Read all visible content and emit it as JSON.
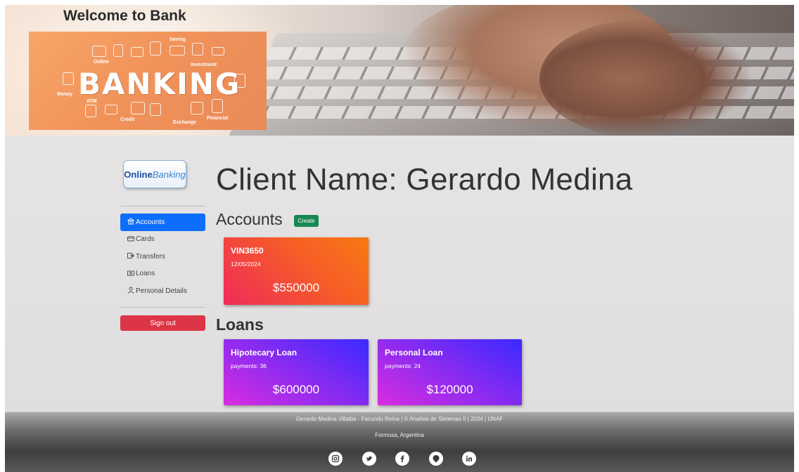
{
  "header": {
    "welcome": "Welcome to Bank",
    "banner_logo": {
      "main_text": "BANKING",
      "words": [
        "Online",
        "Saving",
        "Investment",
        "Money",
        "ATM",
        "Credit",
        "Exchange",
        "Financial"
      ]
    }
  },
  "logo": {
    "part1": "Online",
    "part2": "Banking"
  },
  "client_title": "Client Name: Gerardo Medina",
  "sidebar": {
    "items": [
      {
        "label": "Accounts",
        "icon": "bank-icon",
        "active": true
      },
      {
        "label": "Cards",
        "icon": "credit-card-icon",
        "active": false
      },
      {
        "label": "Transfers",
        "icon": "transfer-icon",
        "active": false
      },
      {
        "label": "Loans",
        "icon": "cash-icon",
        "active": false
      },
      {
        "label": "Personal Details",
        "icon": "person-icon",
        "active": false
      }
    ],
    "signout_label": "Sign out"
  },
  "accounts_section": {
    "title": "Accounts",
    "create_label": "Create",
    "cards": [
      {
        "number": "VIN3650",
        "date": "12/05/2024",
        "balance": "$550000"
      }
    ]
  },
  "loans_section": {
    "title": "Loans",
    "cards": [
      {
        "name": "Hipotecary Loan",
        "payments": "payments: 36",
        "amount": "$600000"
      },
      {
        "name": "Personal Loan",
        "payments": "payments: 24",
        "amount": "$120000"
      }
    ]
  },
  "footer": {
    "credits": "Gerardo Medina Villalba - Facundo Reina | © Analisis de Sistemas II | 2024 | UNAF",
    "location": "Formosa, Argentina",
    "socials": [
      "instagram-icon",
      "twitter-icon",
      "facebook-icon",
      "github-icon",
      "linkedin-icon"
    ]
  },
  "colors": {
    "primary": "#0d6efd",
    "success": "#198754",
    "danger": "#dc3545"
  }
}
